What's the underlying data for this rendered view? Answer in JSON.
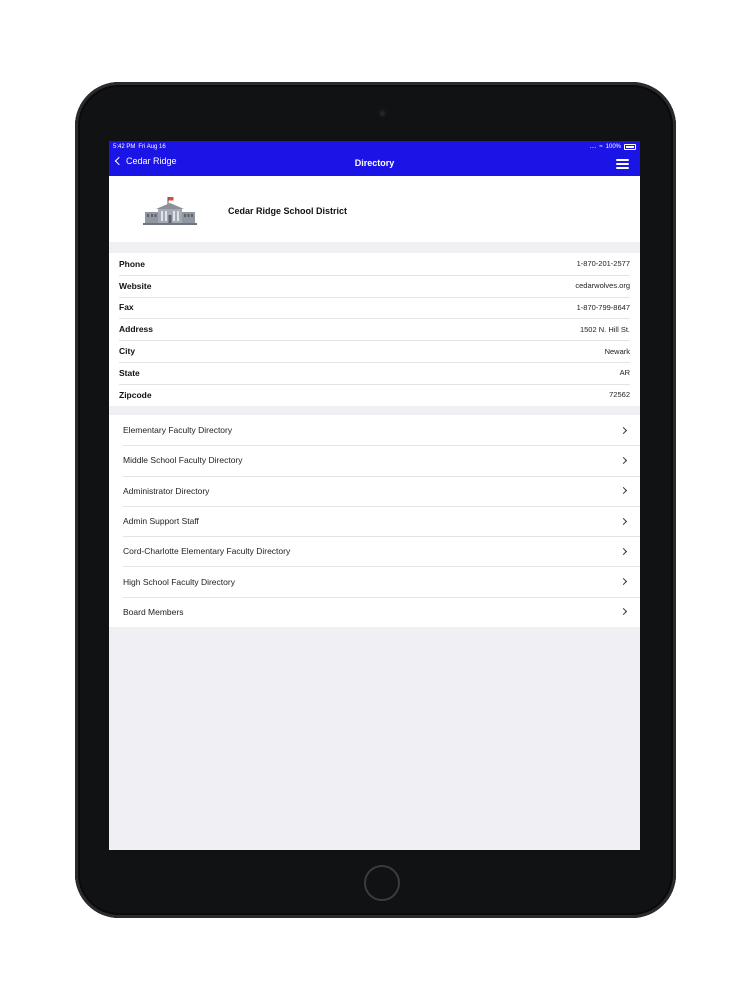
{
  "status_bar": {
    "time": "5:42 PM",
    "date": "Fri Aug 16",
    "signal": "....",
    "battery": "100%"
  },
  "navbar": {
    "back_label": "Cedar Ridge",
    "title": "Directory",
    "accent_color": "#1b14e6"
  },
  "header": {
    "district_name": "Cedar Ridge School District"
  },
  "info": [
    {
      "label": "Phone",
      "value": "1-870-201-2577"
    },
    {
      "label": "Website",
      "value": "cedarwolves.org"
    },
    {
      "label": "Fax",
      "value": "1-870-799-8647"
    },
    {
      "label": "Address",
      "value": "1502 N. Hill St."
    },
    {
      "label": "City",
      "value": "Newark"
    },
    {
      "label": "State",
      "value": "AR"
    },
    {
      "label": "Zipcode",
      "value": "72562"
    }
  ],
  "directories": [
    {
      "label": "Elementary Faculty Directory"
    },
    {
      "label": "Middle School Faculty Directory"
    },
    {
      "label": "Administrator Directory"
    },
    {
      "label": "Admin Support Staff"
    },
    {
      "label": "Cord-Charlotte Elementary Faculty Directory"
    },
    {
      "label": "High School Faculty Directory"
    },
    {
      "label": "Board Members"
    }
  ]
}
